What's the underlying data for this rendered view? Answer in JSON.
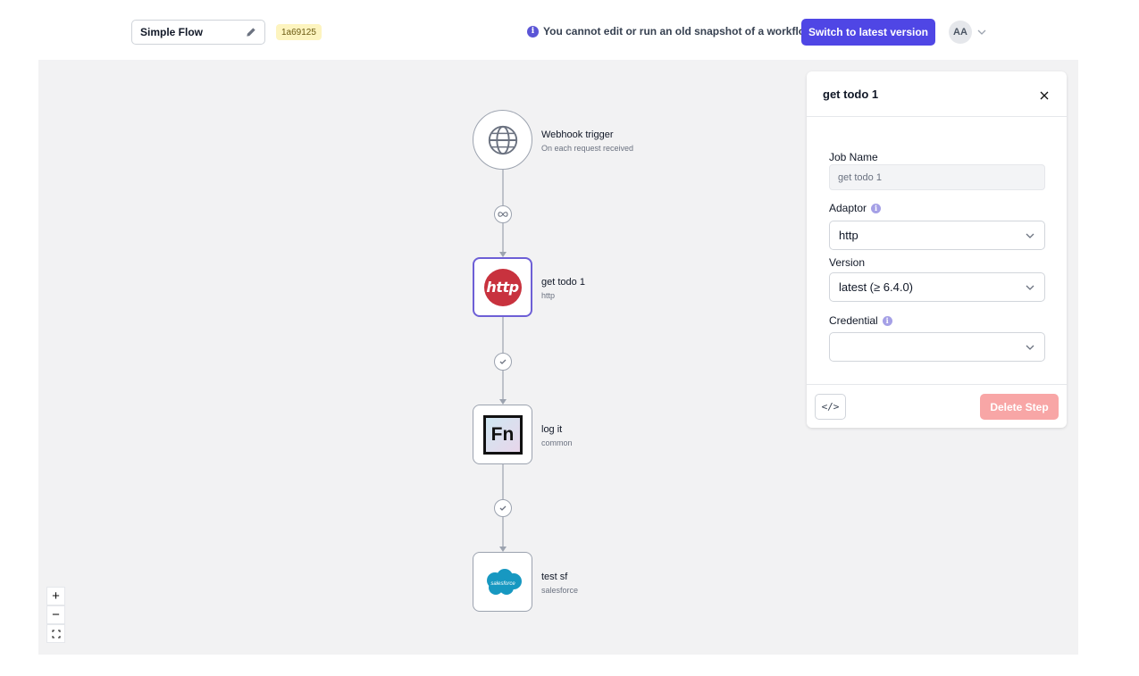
{
  "header": {
    "workflow_name": "Simple Flow",
    "snapshot_id": "1a69125",
    "notice": "You cannot edit or run an old snapshot of a workflow.",
    "switch_button": "Switch to latest version",
    "user_initials": "AA"
  },
  "canvas": {
    "nodes": [
      {
        "label": "Webhook trigger",
        "sublabel": "On each request received",
        "icon": "globe-icon"
      },
      {
        "label": "get todo 1",
        "sublabel": "http",
        "icon": "http-adaptor-icon",
        "logo_text": "http"
      },
      {
        "label": "log it",
        "sublabel": "common",
        "icon": "fn-common-icon",
        "logo_text": "Fn"
      },
      {
        "label": "test sf",
        "sublabel": "salesforce",
        "icon": "salesforce-icon",
        "logo_text": "salesforce"
      }
    ],
    "edges": [
      {
        "marker": "infinity-icon"
      },
      {
        "marker": "check-icon"
      },
      {
        "marker": "check-icon"
      }
    ],
    "zoom_controls": {
      "zoom_in": "+",
      "zoom_out": "−"
    }
  },
  "panel": {
    "title": "get todo 1",
    "job_name_label": "Job Name",
    "job_name_value": "get todo 1",
    "adaptor_label": "Adaptor",
    "adaptor_value": "http",
    "version_label": "Version",
    "version_value": "latest (≥ 6.4.0)",
    "credential_label": "Credential",
    "credential_value": "",
    "code_button": "</>",
    "delete_button": "Delete Step"
  },
  "colors": {
    "primary": "#4f46e5",
    "selected_border": "#6d5fd6",
    "badge_bg": "#fdf4bf",
    "delete_disabled": "#f8a6a6",
    "http_red": "#c8323e",
    "salesforce_blue": "#1798c1"
  }
}
